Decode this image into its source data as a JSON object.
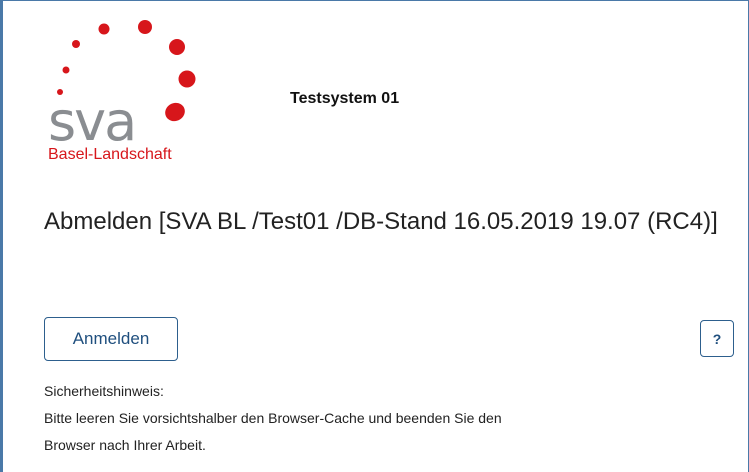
{
  "branding": {
    "logo_text": "sva",
    "logo_subtitle": "Basel-Landschaft",
    "brand_color": "#d7161b"
  },
  "header": {
    "system_title": "Testsystem 01"
  },
  "main": {
    "title": "Abmelden [SVA BL /Test01 /DB-Stand 16.05.2019 19.07 (RC4)]",
    "login_button": "Anmelden",
    "help_button": "?",
    "notice_heading": "Sicherheitshinweis:",
    "notice_line1": "Bitte leeren Sie vorsichtshalber den Browser-Cache und beenden Sie den",
    "notice_line2": "Browser nach Ihrer Arbeit."
  },
  "colors": {
    "frame_border": "#4a79a8",
    "button_border": "#2d5f8d",
    "button_text": "#1f4f7e"
  }
}
